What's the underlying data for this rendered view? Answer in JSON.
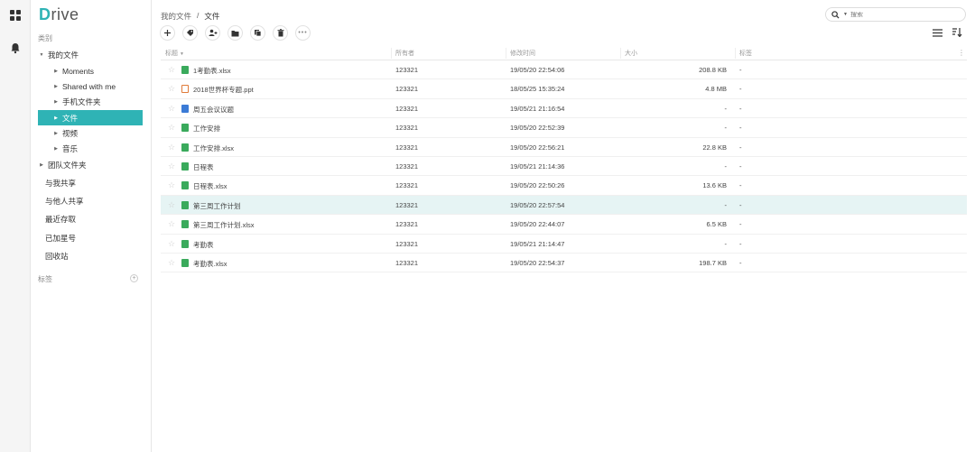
{
  "app": {
    "logo_first": "D",
    "logo_rest": "rive"
  },
  "colors": {
    "accent": "#2fb3b5",
    "selected_row": "#e6f4f4",
    "sheet_icon": "#3aaa5c",
    "doc_icon": "#3b7bd6",
    "ppt_icon": "#e07b39"
  },
  "sidebar": {
    "section_label": "类别",
    "my_files": "我的文件",
    "children": [
      "Moments",
      "Shared with me",
      "手机文件夹",
      "文件",
      "视频",
      "音乐"
    ],
    "team_files": "团队文件夹",
    "links": [
      "与我共享",
      "与他人共享",
      "最近存取",
      "已加星号",
      "回收站"
    ],
    "tags_label": "标签"
  },
  "breadcrumb": {
    "root": "我的文件",
    "sep": "/",
    "current": "文件"
  },
  "search": {
    "placeholder": "搜索"
  },
  "table": {
    "headers": {
      "title": "标题",
      "owner": "所有者",
      "modified": "修改时间",
      "size": "大小",
      "tags": "标签"
    },
    "rows": [
      {
        "name": "1考勤表.xlsx",
        "type": "sheet",
        "owner": "123321",
        "modified": "19/05/20 22:54:06",
        "size": "208.8 KB",
        "tag": "-"
      },
      {
        "name": "2018世界杯专题.ppt",
        "type": "ppt",
        "owner": "123321",
        "modified": "18/05/25 15:35:24",
        "size": "4.8 MB",
        "tag": "-"
      },
      {
        "name": "周五会议议题",
        "type": "doc",
        "owner": "123321",
        "modified": "19/05/21 21:16:54",
        "size": "-",
        "tag": "-"
      },
      {
        "name": "工作安排",
        "type": "sheet",
        "owner": "123321",
        "modified": "19/05/20 22:52:39",
        "size": "-",
        "tag": "-"
      },
      {
        "name": "工作安排.xlsx",
        "type": "sheet",
        "owner": "123321",
        "modified": "19/05/20 22:56:21",
        "size": "22.8 KB",
        "tag": "-"
      },
      {
        "name": "日程表",
        "type": "sheet",
        "owner": "123321",
        "modified": "19/05/21 21:14:36",
        "size": "-",
        "tag": "-"
      },
      {
        "name": "日程表.xlsx",
        "type": "sheet",
        "owner": "123321",
        "modified": "19/05/20 22:50:26",
        "size": "13.6 KB",
        "tag": "-"
      },
      {
        "name": "第三周工作计划",
        "type": "sheet",
        "owner": "123321",
        "modified": "19/05/20 22:57:54",
        "size": "-",
        "tag": "-"
      },
      {
        "name": "第三周工作计划.xlsx",
        "type": "sheet",
        "owner": "123321",
        "modified": "19/05/20 22:44:07",
        "size": "6.5 KB",
        "tag": "-"
      },
      {
        "name": "考勤表",
        "type": "sheet",
        "owner": "123321",
        "modified": "19/05/21 21:14:47",
        "size": "-",
        "tag": "-"
      },
      {
        "name": "考勤表.xlsx",
        "type": "sheet",
        "owner": "123321",
        "modified": "19/05/20 22:54:37",
        "size": "198.7 KB",
        "tag": "-"
      }
    ]
  },
  "toolbar": {
    "icons": [
      "plus-icon",
      "tag-icon",
      "add-user-icon",
      "new-folder-icon",
      "copy-icon",
      "delete-icon",
      "more-icon"
    ]
  }
}
